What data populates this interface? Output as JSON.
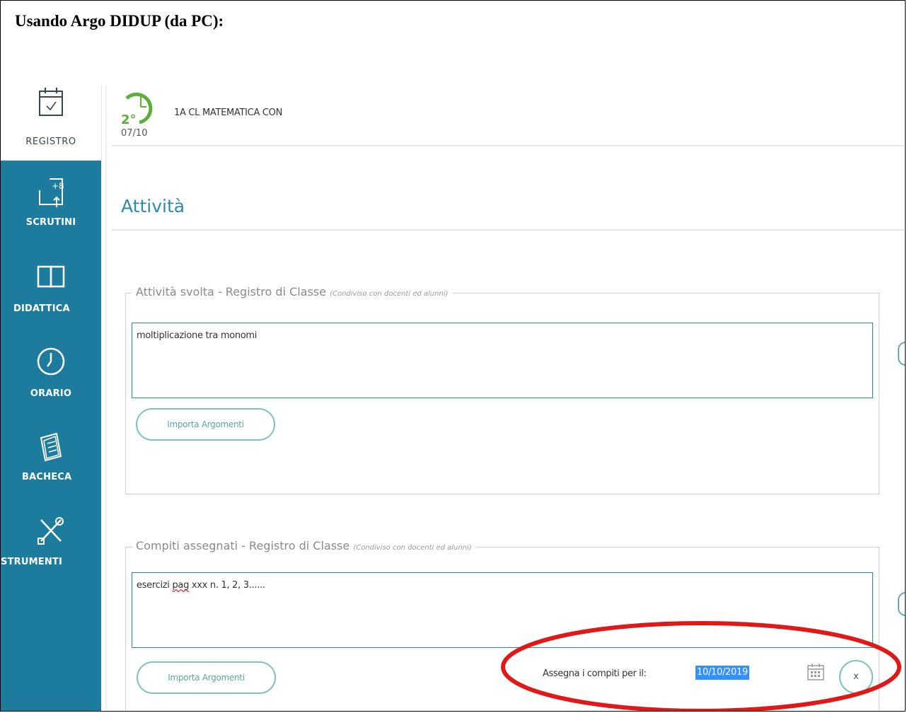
{
  "document": {
    "heading": "Usando Argo DIDUP (da PC):"
  },
  "sidebar": {
    "items": [
      {
        "label": "REGISTRO",
        "icon": "calendar-check-icon"
      },
      {
        "label": "SCRUTINI",
        "icon": "grades-plus-icon"
      },
      {
        "label": "DIDATTICA",
        "icon": "book-icon"
      },
      {
        "label": "ORARIO",
        "icon": "clock-icon"
      },
      {
        "label": "BACHECA",
        "icon": "notice-board-icon"
      },
      {
        "label": "STRUMENTI",
        "icon": "tools-icon"
      }
    ]
  },
  "lesson": {
    "hour": "2°",
    "date": "07/10",
    "title": "1A CL MATEMATICA CON"
  },
  "section": {
    "title": "Attività"
  },
  "activity": {
    "legend": "Attività svolta - Registro di Classe",
    "note": "(Condiviso con docenti ed alunni)",
    "text": "moltiplicazione tra monomi",
    "import_label": "Importa Argomenti"
  },
  "homework": {
    "legend": "Compiti assegnati - Registro di Classe",
    "note": "(Condiviso con docenti ed alunni)",
    "text_before": "esercizi ",
    "text_spell": "pag",
    "text_after": " xxx n. 1, 2, 3......",
    "import_label": "Importa Argomenti",
    "due_label": "Assegna i compiti per il:",
    "due_value": "10/10/2019",
    "clear_label": "x"
  },
  "colors": {
    "sidebar": "#1d7c9d",
    "accent": "#2f8aa8",
    "button_border": "#7fc4b5",
    "highlight": "#e01818",
    "selection": "#3390ff"
  }
}
